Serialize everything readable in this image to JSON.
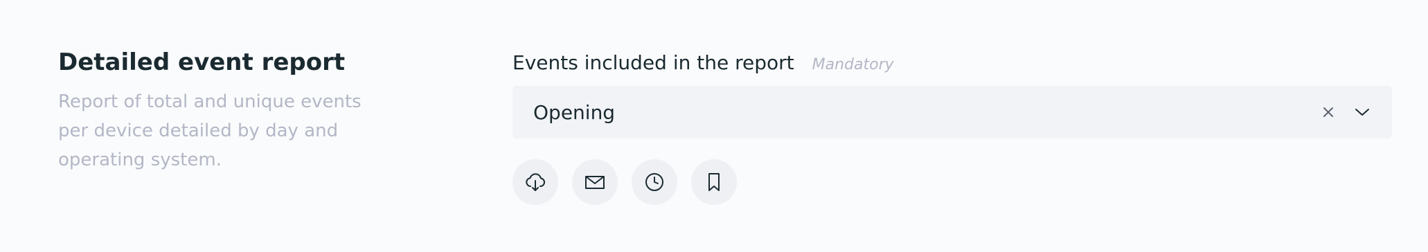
{
  "report": {
    "title": "Detailed event report",
    "description": "Report of total and unique events per device detailed by day and operating system."
  },
  "events_field": {
    "label": "Events included in the report",
    "required_hint": "Mandatory",
    "selected_value": "Opening",
    "icons": [
      "close-icon",
      "chevron-down-icon"
    ]
  },
  "actions": [
    {
      "name": "download",
      "icon": "cloud-download-icon"
    },
    {
      "name": "email",
      "icon": "mail-icon"
    },
    {
      "name": "schedule",
      "icon": "clock-icon"
    },
    {
      "name": "save",
      "icon": "bookmark-icon"
    }
  ],
  "colors": {
    "background": "#fafbfc",
    "title": "#1a2a30",
    "muted_text": "#b3b7c6",
    "field_background": "#f2f3f7",
    "icon_button_background": "#eef0f4"
  }
}
